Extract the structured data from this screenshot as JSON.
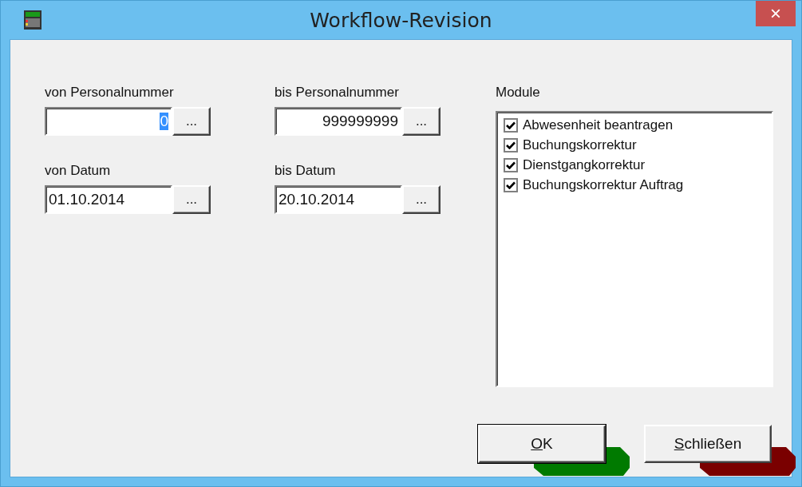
{
  "window": {
    "title": "Workflow-Revision"
  },
  "fields": [
    {
      "label": "von Personalnummer",
      "value": "0",
      "kind": "number",
      "selected": true
    },
    {
      "label": "bis Personalnummer",
      "value": "999999999",
      "kind": "number",
      "selected": false
    },
    {
      "label": "von Datum",
      "value": "01.10.2014",
      "kind": "date",
      "selected": false
    },
    {
      "label": "bis Datum",
      "value": "20.10.2014",
      "kind": "date",
      "selected": false
    }
  ],
  "browse_button": "...",
  "modules": {
    "label": "Module",
    "items": [
      {
        "label": "Abwesenheit beantragen",
        "checked": true
      },
      {
        "label": "Buchungskorrektur",
        "checked": true
      },
      {
        "label": "Dienstgangkorrektur",
        "checked": true
      },
      {
        "label": "Buchungskorrektur Auftrag",
        "checked": true
      }
    ]
  },
  "buttons": [
    {
      "label": "OK",
      "color": "#007a00",
      "default": true
    },
    {
      "label": "Schließen",
      "color": "#7a0000",
      "default": false
    }
  ],
  "close_button": "×"
}
